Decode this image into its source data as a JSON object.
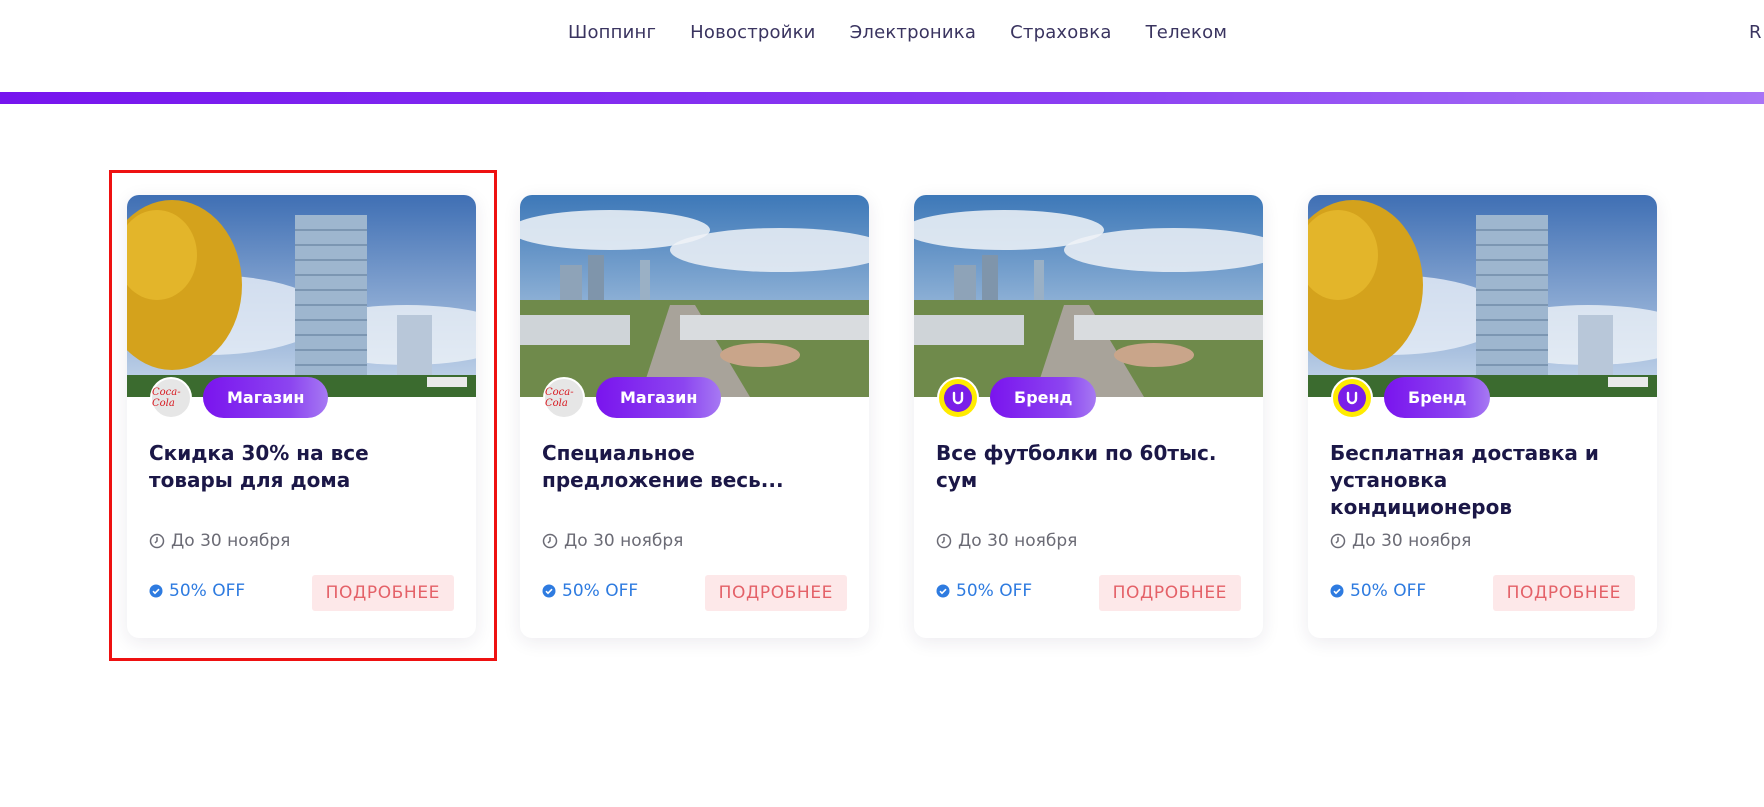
{
  "nav": {
    "items": [
      "Шоппинг",
      "Новостройки",
      "Электроника",
      "Страховка",
      "Телеком"
    ],
    "lang": "R"
  },
  "cards": [
    {
      "brand_icon": "coca-cola-logo",
      "brand_logo_text": "Coca-Cola",
      "category": "Магазин",
      "title": "Скидка 30% на все товары для дома",
      "date": "До 30 ноября",
      "off": "50% OFF",
      "button": "ПОДРОБНЕЕ",
      "image": "tower-building-photo"
    },
    {
      "brand_icon": "coca-cola-logo",
      "brand_logo_text": "Coca-Cola",
      "category": "Магазин",
      "title": "Специальное предложение весь...",
      "date": "До 30 ноября",
      "off": "50% OFF",
      "button": "ПОДРОБНЕЕ",
      "image": "city-panorama-photo"
    },
    {
      "brand_icon": "uzum-logo",
      "category": "Бренд",
      "title": "Все футболки по 60тыс. сум",
      "date": "До 30 ноября",
      "off": "50% OFF",
      "button": "ПОДРОБНЕЕ",
      "image": "city-panorama-photo"
    },
    {
      "brand_icon": "uzum-logo",
      "category": "Бренд",
      "title": "Бесплатная доставка и установка кондиционеров",
      "date": "До 30 ноября",
      "off": "50% OFF",
      "button": "ПОДРОБНЕЕ",
      "image": "tower-building-photo"
    }
  ],
  "colors": {
    "accent": "#7614ee",
    "highlight": "#ee1111",
    "button_bg": "#fde8e9",
    "button_text": "#e46168",
    "off_text": "#2e7be0"
  }
}
